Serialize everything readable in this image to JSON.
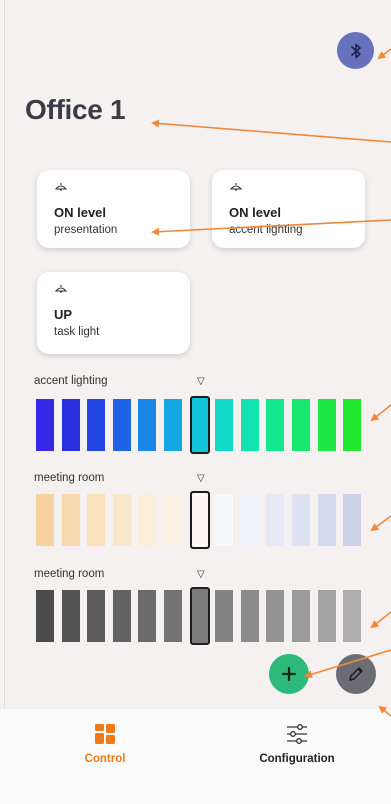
{
  "room": {
    "title": "Office 1"
  },
  "scenes": [
    {
      "title": "ON level",
      "subtitle": "presentation",
      "icon": "ceiling-lamp-icon"
    },
    {
      "title": "ON level",
      "subtitle": "accent lighting",
      "icon": "ceiling-lamp-icon"
    },
    {
      "title": "UP",
      "subtitle": "task light",
      "icon": "ceiling-lamp-icon"
    }
  ],
  "groups": [
    {
      "label": "accent lighting",
      "caret": "▽",
      "colors": [
        "#3a28e8",
        "#2a2fe0",
        "#2244e2",
        "#1e63e6",
        "#1a86e8",
        "#16a6e6",
        "#14c4dc",
        "#12dac8",
        "#12e4b0",
        "#14e690",
        "#18e870",
        "#1ee844",
        "#22e82e"
      ],
      "selected_index": 6
    },
    {
      "label": "meeting room",
      "caret": "▽",
      "colors": [
        "#f7d19f",
        "#f8daae",
        "#f9e1bd",
        "#fae7cb",
        "#fbeeda",
        "#fbf1e4",
        "#fdf8f2",
        "#f8f9fd",
        "#eff2fb",
        "#e6eaf7",
        "#dde2f3",
        "#d4dbee",
        "#ccd3e8"
      ],
      "selected_index": 6
    },
    {
      "label": "meeting room",
      "caret": "▽",
      "colors": [
        "#4b4b4b",
        "#535353",
        "#5b5b5b",
        "#636363",
        "#6b6b6b",
        "#737373",
        "#7b7b7b",
        "#838383",
        "#8b8b8b",
        "#939393",
        "#9b9b9b",
        "#a3a3a3",
        "#adadad"
      ],
      "selected_index": 6
    }
  ],
  "nav": {
    "items": [
      {
        "label": "Control",
        "icon": "grid-icon",
        "active": true
      },
      {
        "label": "Configuration",
        "icon": "sliders-icon",
        "active": false
      }
    ]
  },
  "colors": {
    "accent": "#f07a1a",
    "bluetooth": "#6772bf",
    "add": "#2db97a",
    "edit": "#6c6c74",
    "annotation": "#f0893a"
  }
}
